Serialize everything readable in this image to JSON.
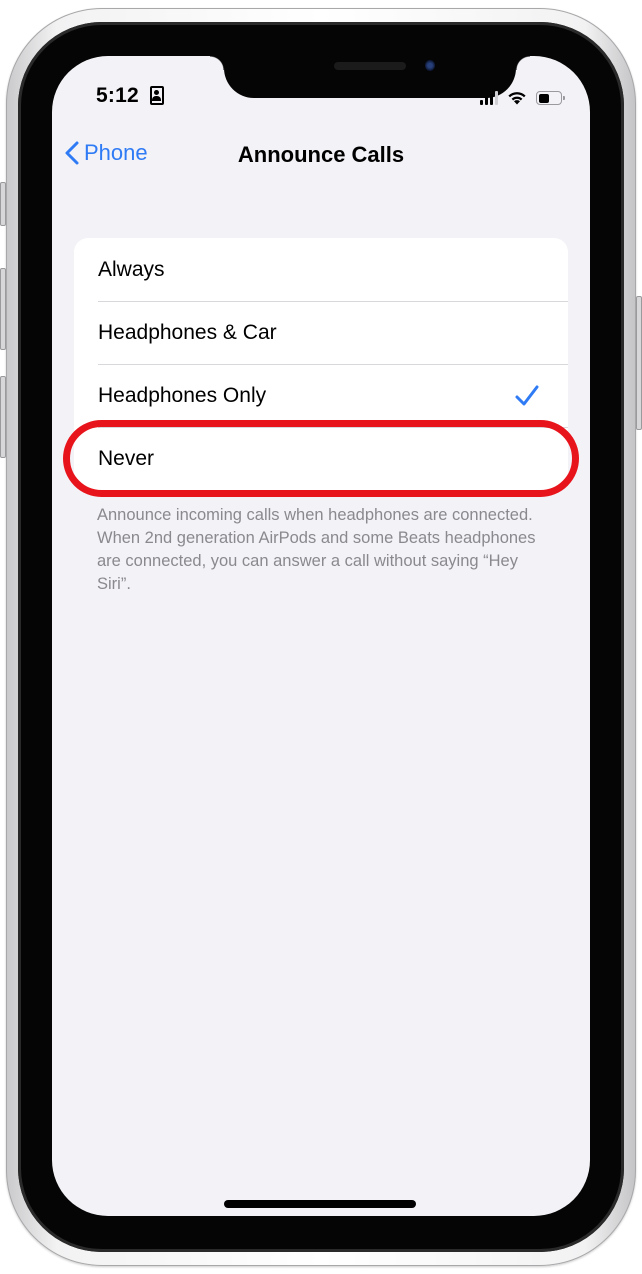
{
  "status_bar": {
    "time": "5:12",
    "focus_icon": "person-badge-icon",
    "signal_bars": 3,
    "signal_bars_total": 4,
    "wifi_icon": "wifi-icon",
    "battery_level": 0.5
  },
  "nav": {
    "back_label": "Phone",
    "back_icon": "chevron-left-icon",
    "title": "Announce Calls"
  },
  "options": [
    {
      "label": "Always",
      "selected": false
    },
    {
      "label": "Headphones & Car",
      "selected": false
    },
    {
      "label": "Headphones Only",
      "selected": true
    },
    {
      "label": "Never",
      "selected": false,
      "highlighted": true
    }
  ],
  "footer": "Announce incoming calls when headphones are connected. When 2nd generation AirPods and some Beats headphones are connected, you can answer a call without saying “Hey Siri”.",
  "colors": {
    "accent": "#2f7bf5",
    "highlight": "#e8141b",
    "background": "#f2f2f7",
    "footer_text": "#8a8a8e"
  }
}
